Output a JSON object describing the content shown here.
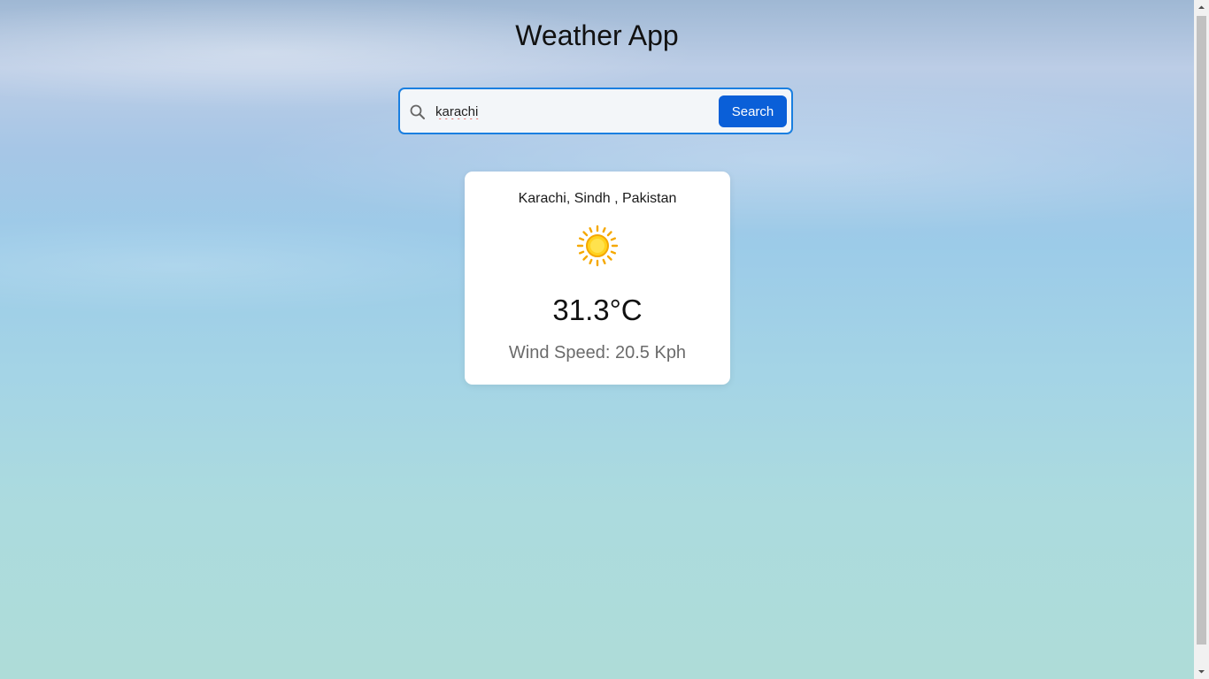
{
  "app": {
    "title": "Weather App"
  },
  "search": {
    "value": "karachi",
    "button_label": "Search",
    "icon": "search-icon",
    "accent_color": "#1a7fe0",
    "button_color": "#0a5fd8"
  },
  "weather": {
    "location": "Karachi, Sindh , Pakistan",
    "icon": "sun-icon",
    "temperature": "31.3°C",
    "wind": "Wind Speed: 20.5 Kph"
  }
}
